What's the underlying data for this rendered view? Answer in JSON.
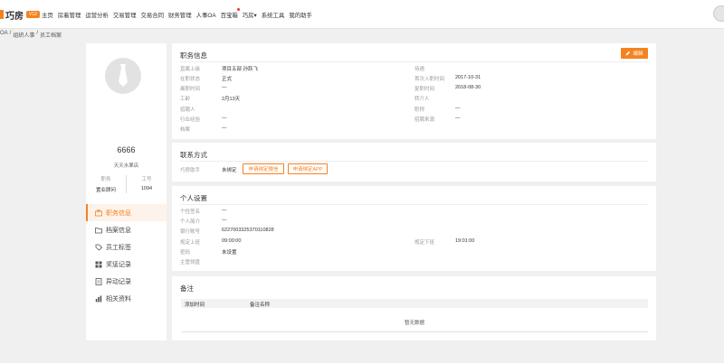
{
  "app": {
    "name": "巧房",
    "badge": "V12"
  },
  "nav": [
    "主页",
    "房着管理",
    "运营分析",
    "交易管理",
    "交易合同",
    "财务管理",
    "人事OA",
    "百宝箱",
    "巧房▾",
    "系统工具",
    "我的助手"
  ],
  "breadcrumb": [
    "OA",
    "/",
    "组织人事",
    "/",
    "员工档案"
  ],
  "profile": {
    "name": "6666",
    "store": "天天水果店",
    "position_label": "职务",
    "position_value": "置业顾问",
    "id_label": "工号",
    "id_value": "1094"
  },
  "menu": [
    {
      "label": "职务信息",
      "icon": "briefcase-icon"
    },
    {
      "label": "档案信息",
      "icon": "folder-icon"
    },
    {
      "label": "员工标签",
      "icon": "tag-icon"
    },
    {
      "label": "奖惩记录",
      "icon": "grid-icon"
    },
    {
      "label": "异动记录",
      "icon": "document-icon"
    },
    {
      "label": "相关资料",
      "icon": "chart-icon"
    }
  ],
  "job": {
    "title": "职务信息",
    "edit": "编辑",
    "left": [
      {
        "label": "直属上级",
        "value": "项目五部 孙跃飞"
      },
      {
        "label": "在职状态",
        "value": "正式"
      },
      {
        "label": "离职时间",
        "value": "—"
      },
      {
        "label": "工龄",
        "value": "2月13天"
      },
      {
        "label": "招聘人",
        "value": ""
      },
      {
        "label": "行业经验",
        "value": "—"
      },
      {
        "label": "档案",
        "value": "—"
      }
    ],
    "right": [
      {
        "label": "待遇",
        "value": ""
      },
      {
        "label": "首次入职时间",
        "value": "2017-10-31"
      },
      {
        "label": "复职时间",
        "value": "2018-08-30"
      },
      {
        "label": "转介人",
        "value": ""
      },
      {
        "label": "职称",
        "value": "—"
      },
      {
        "label": "招聘来源",
        "value": "—"
      }
    ]
  },
  "contact": {
    "title": "联系方式",
    "label": "巧房助手",
    "status": "未绑定",
    "btn_wechat": "申请绑定微信",
    "btn_app": "申请绑定APP"
  },
  "personal": {
    "title": "个人设置",
    "left": [
      {
        "label": "个性签名",
        "value": "—"
      },
      {
        "label": "个人简介",
        "value": "—"
      },
      {
        "label": "银行账号",
        "value": "6227003325370110828"
      },
      {
        "label": "规定上班",
        "value": "09:00:00"
      },
      {
        "label": "密码",
        "value": "未设置"
      },
      {
        "label": "主管领盘",
        "value": ""
      }
    ],
    "right": [
      {
        "label": "规定下班",
        "value": "19:01:00"
      }
    ]
  },
  "remarks": {
    "title": "备注",
    "col_time": "添加时间",
    "col_name": "备注名称",
    "empty": "暂无数据"
  },
  "colors": {
    "accent": "#f58220"
  }
}
